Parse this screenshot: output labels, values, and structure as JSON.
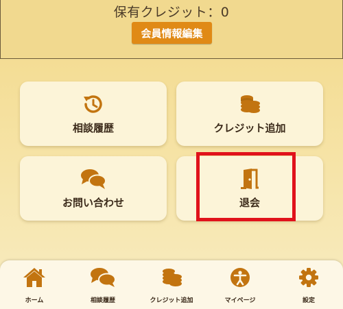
{
  "header": {
    "credit_text": "保有クレジット：0",
    "edit_button_label": "会員情報編集"
  },
  "menu": {
    "history_label": "相談履歴",
    "credit_add_label": "クレジット追加",
    "contact_label": "お問い合わせ",
    "withdraw_label": "退会"
  },
  "bottom_nav": {
    "home": "ホーム",
    "history": "相談履歴",
    "credit_add": "クレジット追加",
    "mypage": "マイページ",
    "settings": "設定"
  },
  "colors": {
    "accent": "#c27410",
    "button": "#e08a16",
    "highlight": "#e0121b"
  }
}
